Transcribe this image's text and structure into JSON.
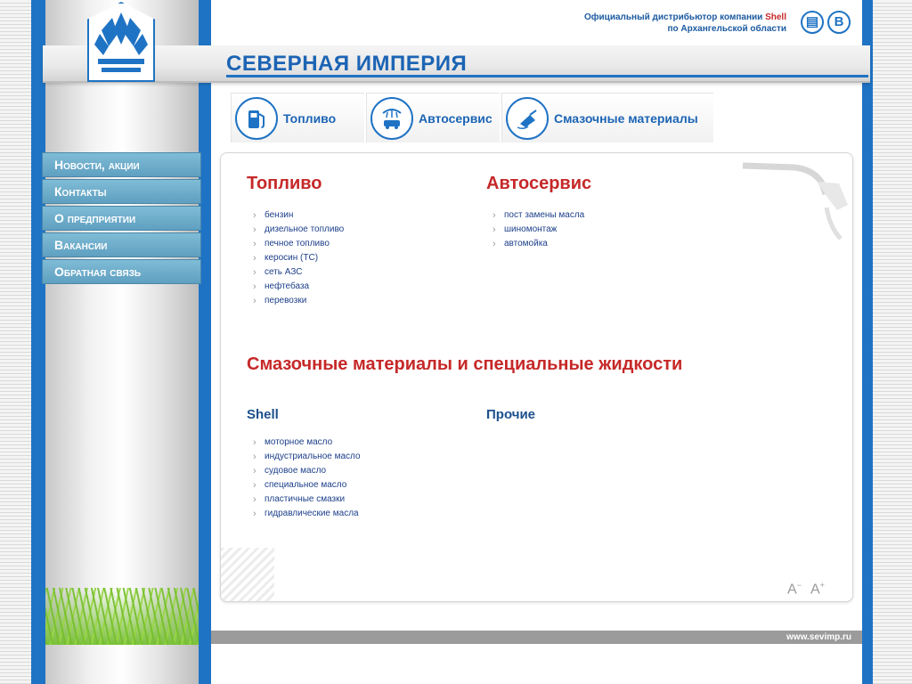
{
  "header": {
    "brand_name": "СЕВЕРНАЯ ИМПЕРИЯ",
    "distributor_line1_prefix": "Официальный дистрибьютор компании ",
    "distributor_line1_brand": "Shell",
    "distributor_line2": "по Архангельской области",
    "icons": [
      {
        "name": "document-icon",
        "glyph": "▤"
      },
      {
        "name": "vk-icon",
        "glyph": "B"
      }
    ]
  },
  "tabs": [
    {
      "label": "Топливо",
      "icon": "fuel-pump-icon"
    },
    {
      "label": "Автосервис",
      "icon": "car-wash-icon"
    },
    {
      "label": "Смазочные материалы",
      "icon": "oil-can-icon"
    }
  ],
  "nav": {
    "items": [
      {
        "label": "Новости, акции"
      },
      {
        "label": "Контакты"
      },
      {
        "label": "О предприятии"
      },
      {
        "label": "Вакансии"
      },
      {
        "label": "Обратная связь"
      }
    ]
  },
  "content": {
    "fuel": {
      "title": "Топливо",
      "items": [
        "бензин",
        "дизельное топливо",
        "печное топливо",
        "керосин (ТС)",
        "сеть АЗС",
        "нефтебаза",
        "перевозки"
      ]
    },
    "autoservice": {
      "title": "Автосервис",
      "items": [
        "пост замены масла",
        "шиномонтаж",
        "автомойка"
      ]
    },
    "lubricants": {
      "title": "Смазочные материалы и специальные жидкости",
      "shell": {
        "title": "Shell",
        "items": [
          "моторное масло",
          "индустриальное масло",
          "судовое масло",
          "специальное масло",
          "пластичные смазки",
          "гидравлические масла"
        ]
      },
      "other": {
        "title": "Прочие",
        "items": []
      }
    }
  },
  "font_controls": {
    "decrease": "A",
    "decrease_mark": "−",
    "increase": "A",
    "increase_mark": "+"
  },
  "footer": {
    "url": "www.sevimp.ru"
  },
  "colors": {
    "accent_blue": "#1f73c4",
    "title_red": "#c62828",
    "nav_bg": "#6fb0cf"
  }
}
